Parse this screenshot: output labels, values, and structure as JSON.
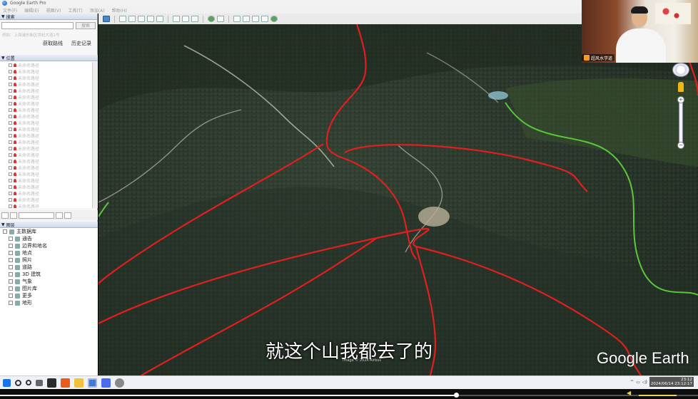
{
  "window": {
    "title": "Google Earth Pro"
  },
  "menu": [
    "文件(F)",
    "编辑(E)",
    "视图(V)",
    "工具(T)",
    "添加(A)",
    "帮助(H)"
  ],
  "search": {
    "section_label": "搜索",
    "button_label": "搜索",
    "hint": "例如：上海浦东新区世纪大道1号",
    "get_directions": "获取路线",
    "history": "历史记录"
  },
  "places": {
    "section_label": "位置",
    "items": [
      "未命名路径",
      "未命名路径",
      "未命名路径",
      "未命名路径",
      "未命名路径",
      "未命名路径",
      "未命名路径",
      "未命名路径",
      "未命名路径",
      "未命名路径",
      "未命名路径",
      "未命名路径",
      "未命名路径",
      "未命名路径",
      "未命名路径",
      "未命名路径",
      "未命名路径",
      "未命名路径",
      "未命名路径",
      "未命名路径",
      "未命名路径",
      "未命名路径",
      "未命名路径"
    ],
    "selected": "未命名路径"
  },
  "layers": {
    "section_label": "图层",
    "items": [
      "主数据库",
      "通告",
      "边界和地名",
      "地点",
      "照片",
      "道路",
      "3D 建筑",
      "气象",
      "图片库",
      "更多",
      "地形"
    ]
  },
  "video": {
    "subtitle": "就这个山我都去了的",
    "map_logo": "Google Earth",
    "attribution": "Image © 2024 Airbus"
  },
  "webcam": {
    "label": "超风水学道"
  },
  "taskbar": {
    "time": "23:12",
    "datetime": "2024/06/14 23:12:17"
  },
  "player": {
    "progress": 0.653,
    "volume": 0.96
  },
  "colors": {
    "boundary": "#e01f1f",
    "road": "#5ac83a",
    "accent": "#1a5fb4"
  },
  "icons": [
    "google-earth-icon",
    "compass-icon",
    "pegman-icon",
    "zoom-slider-icon",
    "windows-start-icon",
    "speaker-icon"
  ]
}
